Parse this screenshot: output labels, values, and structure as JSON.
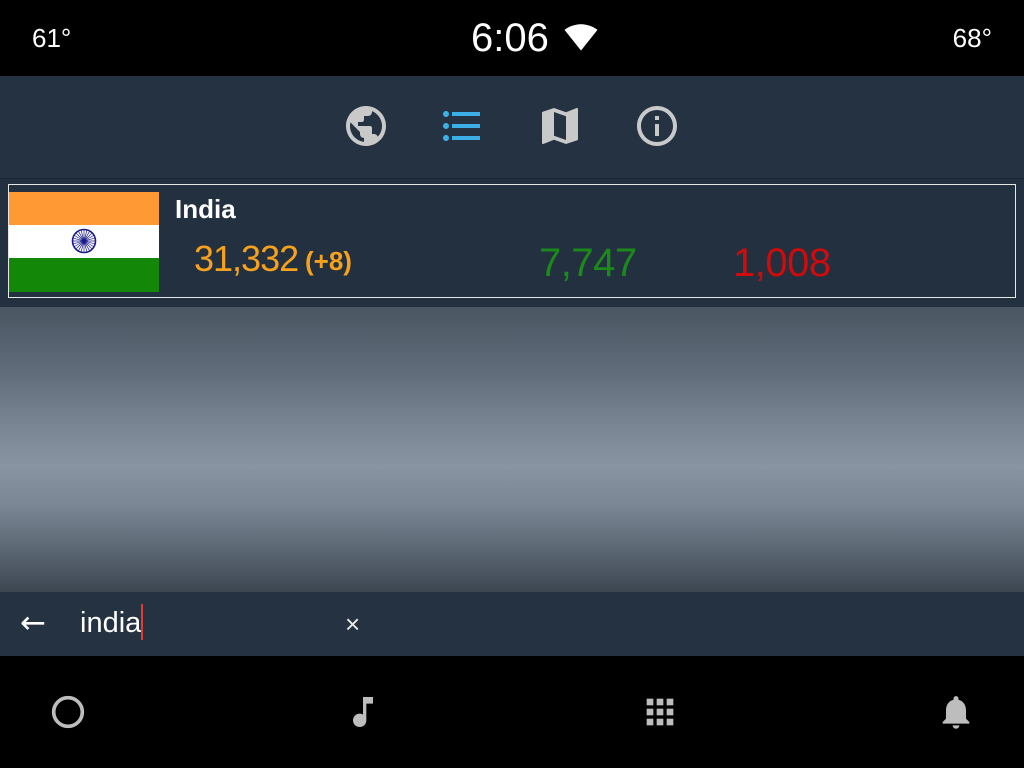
{
  "status_bar": {
    "left_temp": "61°",
    "time": "6:06",
    "right_temp": "68°",
    "wifi_icon": "wifi-icon"
  },
  "tabs": [
    {
      "icon": "globe-icon",
      "active": false
    },
    {
      "icon": "list-icon",
      "active": true
    },
    {
      "icon": "map-icon",
      "active": false
    },
    {
      "icon": "info-icon",
      "active": false
    }
  ],
  "countries": [
    {
      "name": "India",
      "flag_icon": "india-flag",
      "confirmed": "31,332",
      "new_cases": "(+8)",
      "recovered": "7,747",
      "deaths": "1,008"
    }
  ],
  "search": {
    "back_label": "←",
    "value": "india",
    "clear_label": "×"
  },
  "bottom_nav": [
    {
      "icon": "home-circle-icon"
    },
    {
      "icon": "music-note-icon"
    },
    {
      "icon": "apps-grid-icon"
    },
    {
      "icon": "notifications-bell-icon"
    }
  ],
  "colors": {
    "accent": "#3cb0e6",
    "confirmed": "#f7a11d",
    "recovered": "#1b8a1b",
    "deaths": "#cf0b0b"
  }
}
